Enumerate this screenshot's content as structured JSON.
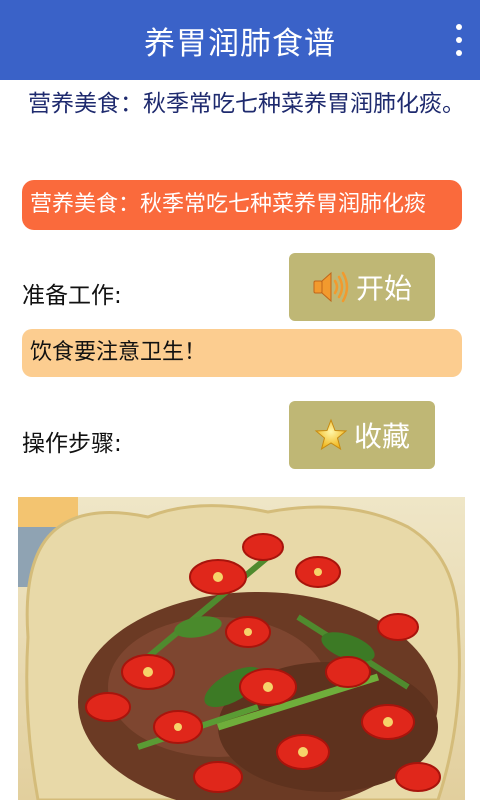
{
  "app": {
    "title": "养胃润肺食谱"
  },
  "article": {
    "title": "营养美食：秋季常吃七种菜养胃润肺化痰。",
    "banner": "营养美食：秋季常吃七种菜养胃润肺化痰"
  },
  "prepare": {
    "label": "准备工作:",
    "button_label": "开始",
    "button_icon": "speaker-icon"
  },
  "notice": {
    "text": "饮食要注意卫生！"
  },
  "steps": {
    "label": "操作步骤:",
    "button_label": "收藏",
    "button_icon": "star-icon"
  },
  "colors": {
    "appbar": "#3a62c8",
    "banner": "#fa6a3c",
    "notice": "#fccd90",
    "button": "#bfb775"
  }
}
